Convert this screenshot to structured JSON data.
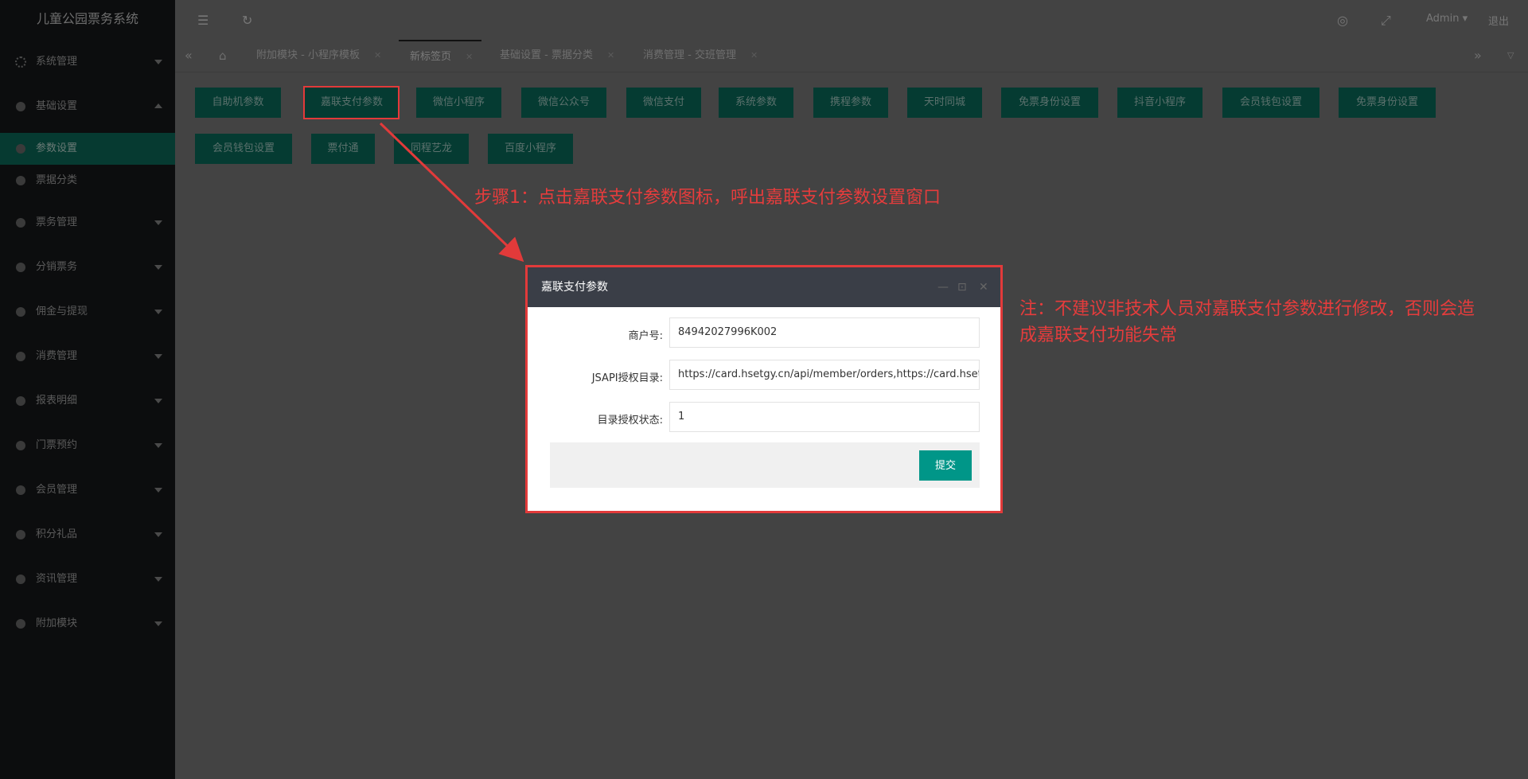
{
  "app": {
    "title": "儿童公园票务系统"
  },
  "sidebar": {
    "items": [
      {
        "label": "系统管理",
        "icon": "gear-icon"
      },
      {
        "label": "基础设置",
        "icon": "dot-icon"
      },
      {
        "label": "参数设置",
        "icon": "dot-icon"
      },
      {
        "label": "票据分类",
        "icon": "dot-icon"
      },
      {
        "label": "票务管理",
        "icon": "dot-icon"
      },
      {
        "label": "分销票务",
        "icon": "dot-icon"
      },
      {
        "label": "佣金与提现",
        "icon": "dot-icon"
      },
      {
        "label": "消费管理",
        "icon": "dot-icon"
      },
      {
        "label": "报表明细",
        "icon": "dot-icon"
      },
      {
        "label": "门票预约",
        "icon": "dot-icon"
      },
      {
        "label": "会员管理",
        "icon": "dot-icon"
      },
      {
        "label": "积分礼品",
        "icon": "dot-icon"
      },
      {
        "label": "资讯管理",
        "icon": "dot-icon"
      },
      {
        "label": "附加模块",
        "icon": "dot-icon"
      }
    ]
  },
  "header": {
    "user": "Admin",
    "logout": "退出"
  },
  "tabs": [
    {
      "label": "附加模块 - 小程序模板"
    },
    {
      "label": "新标签页"
    },
    {
      "label": "基础设置 - 票据分类"
    },
    {
      "label": "消费管理 - 交班管理"
    }
  ],
  "param_buttons": {
    "row1": [
      "自助机参数",
      "嘉联支付参数",
      "微信小程序",
      "微信公众号",
      "微信支付",
      "系统参数",
      "携程参数",
      "天时同城",
      "免票身份设置",
      "抖音小程序",
      "会员钱包设置",
      "免票身份设置"
    ],
    "row2": [
      "会员钱包设置",
      "票付通",
      "同程艺龙",
      "百度小程序"
    ]
  },
  "annotations": {
    "step1": "步骤1：点击嘉联支付参数图标，呼出嘉联支付参数设置窗口",
    "note_line1": "注：不建议非技术人员对嘉联支付参数进行修改，否则会造",
    "note_line2": "成嘉联支付功能失常"
  },
  "dialog": {
    "title": "嘉联支付参数",
    "fields": [
      {
        "label": "商户号:",
        "value": "84942027996K002"
      },
      {
        "label": "JSAPI授权目录:",
        "value": "https://card.hsetgy.cn/api/member/orders,https://card.hsetgy.cn"
      },
      {
        "label": "目录授权状态:",
        "value": "1"
      }
    ],
    "submit": "提交"
  },
  "colors": {
    "accent": "#009688",
    "annotation": "#e23a3a",
    "dialog_header": "#3a3e47"
  }
}
